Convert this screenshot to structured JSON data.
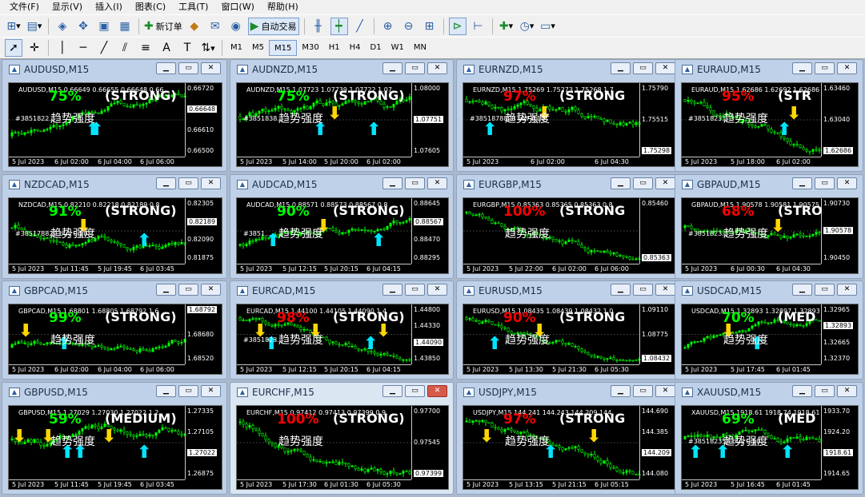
{
  "menu": [
    "文件(F)",
    "显示(V)",
    "插入(I)",
    "图表(C)",
    "工具(T)",
    "窗口(W)",
    "帮助(H)"
  ],
  "toolbar": {
    "new_order": "新订单",
    "auto_trading": "自动交易",
    "timeframes": [
      "M1",
      "M5",
      "M15",
      "M30",
      "H1",
      "H4",
      "D1",
      "W1",
      "MN"
    ],
    "active_timeframe": "M15"
  },
  "colors": {
    "strong_pct": "#ff0000",
    "medium_pct": "#00ff00",
    "bull": "#00ff00",
    "up_arrow": "#00e5ff",
    "down_arrow": "#ffd700"
  },
  "charts": [
    {
      "title": "AUDUSD,M15",
      "header": "AUDUSD,M15  0.66649 0.66655 0.66648 0.66",
      "pct": "75%",
      "pct_color": "#00ff00",
      "strength": "(STRONG)",
      "label": "趋势强度",
      "order": "#3851822...",
      "prices": [
        "0.66720",
        "0.66648",
        "0.66610",
        "0.66500"
      ],
      "current": "0.66648",
      "times": [
        "5 Jul 2023",
        "6 Jul 02:00",
        "6 Jul 04:00",
        "6 Jul 06:00"
      ],
      "trend": "up",
      "arrows": [
        {
          "t": "up",
          "p": 0.48
        },
        {
          "t": "up",
          "p": 0.5
        }
      ]
    },
    {
      "title": "AUDNZD,M15",
      "header": "AUDNZD,M15  1.07723 1.07739 1.07722 1.07",
      "pct": "75%",
      "pct_color": "#00ff00",
      "strength": "(STRONG)",
      "label": "趋势强度",
      "order": "#3851838...",
      "prices": [
        "1.08000",
        "1.07751",
        "1.07605"
      ],
      "current": "1.07751",
      "times": [
        "5 Jul 2023",
        "5 Jul 14:00",
        "5 Jul 20:00",
        "6 Jul 02:00"
      ],
      "trend": "flat",
      "arrows": [
        {
          "t": "up",
          "p": 0.48
        },
        {
          "t": "down",
          "p": 0.57
        },
        {
          "t": "up",
          "p": 0.82
        }
      ]
    },
    {
      "title": "EURNZD,M15",
      "header": "EURNZD,M15  1.75269 1.75273 1.75268 1.7",
      "pct": "97%",
      "pct_color": "#ff0000",
      "strength": "(STRONG",
      "label": "趋势强度",
      "order": "#3851878808 sell 0.10",
      "prices": [
        "1.75790",
        "1.75515",
        "1.75298"
      ],
      "current": "1.75298",
      "times": [
        "5 Jul 2023",
        "6 Jul 02:00",
        "6 Jul 04:30"
      ],
      "trend": "down",
      "arrows": [
        {
          "t": "up",
          "p": 0.12
        },
        {
          "t": "down",
          "p": 0.46
        }
      ]
    },
    {
      "title": "EURAUD,M15",
      "header": "EURAUD,M15  1.62686 1.62692 1.62686 1.62",
      "pct": "95%",
      "pct_color": "#ff0000",
      "strength": "(STR",
      "label": "趋势强度",
      "order": "#3851823...",
      "prices": [
        "1.63460",
        "1.63040",
        "1.62686"
      ],
      "current": "1.62686",
      "times": [
        "5 Jul 2023",
        "5 Jul 18:00",
        "6 Jul 02:00"
      ],
      "trend": "down",
      "arrows": [
        {
          "t": "up",
          "p": 0.77
        },
        {
          "t": "down",
          "p": 0.85
        }
      ]
    },
    {
      "title": "NZDCAD,M15",
      "header": "NZDCAD,M15  0.82210 0.82218 0.82189 0.8",
      "pct": "91%",
      "pct_color": "#00ff00",
      "strength": "(STRONG)",
      "label": "趋势强度",
      "order": "#385178829 buy 0.10",
      "prices": [
        "0.82305",
        "0.82189",
        "0.82090",
        "0.81875"
      ],
      "current": "0.82189",
      "times": [
        "5 Jul 2023",
        "5 Jul 11:45",
        "5 Jul 19:45",
        "6 Jul 03:45"
      ],
      "trend": "flat",
      "arrows": [
        {
          "t": "down",
          "p": 0.42
        },
        {
          "t": "up",
          "p": 0.8
        }
      ]
    },
    {
      "title": "AUDCAD,M15",
      "header": "AUDCAD,M15  0.88571 0.88573 0.88567 0.8",
      "pct": "90%",
      "pct_color": "#00ff00",
      "strength": "(STRONG)",
      "label": "趋势强度",
      "order": "#3851...",
      "prices": [
        "0.88645",
        "0.88567",
        "0.88470",
        "0.88295"
      ],
      "current": "0.88567",
      "times": [
        "5 Jul 2023",
        "5 Jul 12:15",
        "5 Jul 20:15",
        "6 Jul 04:15"
      ],
      "trend": "up",
      "arrows": [
        {
          "t": "up",
          "p": 0.18
        },
        {
          "t": "down",
          "p": 0.5
        },
        {
          "t": "up",
          "p": 0.85
        }
      ]
    },
    {
      "title": "EURGBP,M15",
      "header": "EURGBP,M15  0.85363 0.85365 0.85363 0.8",
      "pct": "100%",
      "pct_color": "#ff0000",
      "strength": "(STRONG",
      "label": "趋势强度",
      "order": "",
      "prices": [
        "0.85460",
        "0.85363"
      ],
      "current": "0.85363",
      "times": [
        "5 Jul 2023",
        "5 Jul 22:00",
        "6 Jul 02:00",
        "6 Jul 06:00"
      ],
      "trend": "down",
      "arrows": []
    },
    {
      "title": "GBPAUD,M15",
      "header": "GBPAUD,M15  1.90578 1.90581 1.90575 1.9",
      "pct": "68%",
      "pct_color": "#ff0000",
      "strength": "(STRO",
      "label": "趋势强度",
      "order": "#3851823...",
      "prices": [
        "1.90730",
        "1.90578",
        "1.90450"
      ],
      "current": "1.90578",
      "times": [
        "5 Jul 2023",
        "6 Jul 00:30",
        "6 Jul 04:30"
      ],
      "trend": "flat",
      "arrows": [
        {
          "t": "down",
          "p": 0.72
        }
      ]
    },
    {
      "title": "GBPCAD,M15",
      "header": "GBPCAD,M15  1.68801 1.68805 1.68792 1.6",
      "pct": "99%",
      "pct_color": "#00ff00",
      "strength": "(STRONG)",
      "label": "趋势强度",
      "order": "",
      "prices": [
        "1.68792",
        "1.68680",
        "1.68520"
      ],
      "current": "1.68792",
      "times": [
        "5 Jul 2023",
        "6 Jul 02:00",
        "6 Jul 04:00",
        "6 Jul 06:00"
      ],
      "trend": "up",
      "arrows": [
        {
          "t": "down",
          "p": 0.06
        },
        {
          "t": "up",
          "p": 0.3
        }
      ]
    },
    {
      "title": "EURCAD,M15",
      "header": "EURCAD,M15  1.44100 1.44105 1.44090 1.4",
      "pct": "98%",
      "pct_color": "#ff0000",
      "strength": "(STRONG)",
      "label": "趋势强度",
      "order": "#3851823...",
      "prices": [
        "1.44800",
        "1.44330",
        "1.44090",
        "1.43850"
      ],
      "current": "1.44090",
      "times": [
        "5 Jul 2023",
        "5 Jul 12:15",
        "5 Jul 20:15",
        "6 Jul 04:15"
      ],
      "trend": "down",
      "arrows": [
        {
          "t": "down",
          "p": 0.1
        },
        {
          "t": "up",
          "p": 0.17
        },
        {
          "t": "down",
          "p": 0.45
        },
        {
          "t": "up",
          "p": 0.8
        },
        {
          "t": "down",
          "p": 0.88
        }
      ]
    },
    {
      "title": "EURUSD,M15",
      "header": "EURUSD,M15  1.08435 1.08439 1.08432 1.0",
      "pct": "90%",
      "pct_color": "#ff0000",
      "strength": "(STRONG",
      "label": "趋势强度",
      "order": "",
      "prices": [
        "1.09110",
        "1.08775",
        "1.08432"
      ],
      "current": "1.08432",
      "times": [
        "5 Jul 2023",
        "5 Jul 13:30",
        "5 Jul 21:30",
        "6 Jul 05:30"
      ],
      "trend": "down",
      "arrows": [
        {
          "t": "up",
          "p": 0.15
        },
        {
          "t": "down",
          "p": 0.43
        }
      ]
    },
    {
      "title": "USDCAD,M15",
      "header": "USDCAD,M15  1.32893 1.32897 1.32893 1.3",
      "pct": "70%",
      "pct_color": "#00ff00",
      "strength": "(MED",
      "label": "趋势强度",
      "order": "",
      "prices": [
        "1.32965",
        "1.32893",
        "1.32665",
        "1.32370"
      ],
      "current": "1.32893",
      "times": [
        "5 Jul 2023",
        "5 Jul 17:45",
        "6 Jul 01:45"
      ],
      "trend": "up",
      "arrows": [
        {
          "t": "down",
          "p": 0.32
        },
        {
          "t": "up",
          "p": 0.55
        }
      ]
    },
    {
      "title": "GBPUSD,M15",
      "header": "GBPUSD,M15  1.27029 1.27030 1.27022 1.2",
      "pct": "59%",
      "pct_color": "#00ff00",
      "strength": "(MEDIUM)",
      "label": "趋势强度",
      "order": "",
      "prices": [
        "1.27335",
        "1.27105",
        "1.27022",
        "1.26875"
      ],
      "current": "1.27022",
      "times": [
        "5 Jul 2023",
        "5 Jul 11:45",
        "5 Jul 19:45",
        "6 Jul 03:45"
      ],
      "trend": "flat",
      "arrows": [
        {
          "t": "down",
          "p": 0.02
        },
        {
          "t": "down",
          "p": 0.2
        },
        {
          "t": "up",
          "p": 0.32
        },
        {
          "t": "up",
          "p": 0.4
        },
        {
          "t": "down",
          "p": 0.58
        },
        {
          "t": "up",
          "p": 0.8
        }
      ]
    },
    {
      "title": "EURCHF,M15",
      "header": "EURCHF,M15  0.97412 0.97413 0.97399 0.9",
      "pct": "100%",
      "pct_color": "#ff0000",
      "strength": "(STRONG)",
      "label": "趋势强度",
      "order": "",
      "prices": [
        "0.97700",
        "0.97545",
        "0.97399"
      ],
      "current": "0.97399",
      "times": [
        "5 Jul 2023",
        "5 Jul 17:30",
        "6 Jul 01:30",
        "6 Jul 05:30"
      ],
      "trend": "down",
      "arrows": []
    },
    {
      "title": "USDJPY,M15",
      "header": "USDJPY,M15  144.241 144.243 144.209 144",
      "pct": "97%",
      "pct_color": "#ff0000",
      "strength": "(STRONG",
      "label": "趋势强度",
      "order": "",
      "prices": [
        "144.690",
        "144.385",
        "144.209",
        "144.080"
      ],
      "current": "144.209",
      "times": [
        "5 Jul 2023",
        "5 Jul 13:15",
        "5 Jul 21:15",
        "6 Jul 05:15"
      ],
      "trend": "down",
      "arrows": [
        {
          "t": "down",
          "p": 0.1
        },
        {
          "t": "up",
          "p": 0.5
        },
        {
          "t": "down",
          "p": 0.77
        }
      ]
    },
    {
      "title": "XAUUSD,M15",
      "header": "XAUUSD,M15  1918.61 1918.74 1918.61 1918",
      "pct": "69%",
      "pct_color": "#00ff00",
      "strength": "(MED",
      "label": "趋势强度",
      "order": "#385182353 buy 0.10",
      "prices": [
        "1933.70",
        "1924.20",
        "1918.61",
        "1914.65"
      ],
      "current": "1918.61",
      "times": [
        "5 Jul 2023",
        "5 Jul 16:45",
        "6 Jul 01:45"
      ],
      "trend": "flat",
      "arrows": [
        {
          "t": "up",
          "p": 0.05
        },
        {
          "t": "up",
          "p": 0.27
        },
        {
          "t": "up",
          "p": 0.8
        }
      ]
    }
  ]
}
